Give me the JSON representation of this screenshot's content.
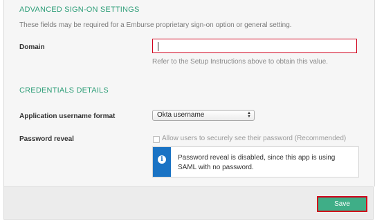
{
  "advanced_signon": {
    "title": "ADVANCED SIGN-ON SETTINGS",
    "description": "These fields may be required for a Emburse proprietary sign-on option or general setting.",
    "domain": {
      "label": "Domain",
      "value": "",
      "helper": "Refer to the Setup Instructions above to obtain this value."
    }
  },
  "credentials": {
    "title": "CREDENTIALS DETAILS",
    "username_format": {
      "label": "Application username format",
      "selected": "Okta username"
    },
    "password_reveal": {
      "label": "Password reveal",
      "checkbox_label": "Allow users to securely see their password (Recommended)",
      "checked": false,
      "info_icon": "info-icon",
      "info_text": "Password reveal is disabled, since this app is using SAML with no password."
    }
  },
  "footer": {
    "save_label": "Save"
  },
  "colors": {
    "section_title": "#2e9e78",
    "highlight_border": "#d0001b",
    "info_blue": "#1a73c4",
    "save_button": "#3fae87"
  }
}
